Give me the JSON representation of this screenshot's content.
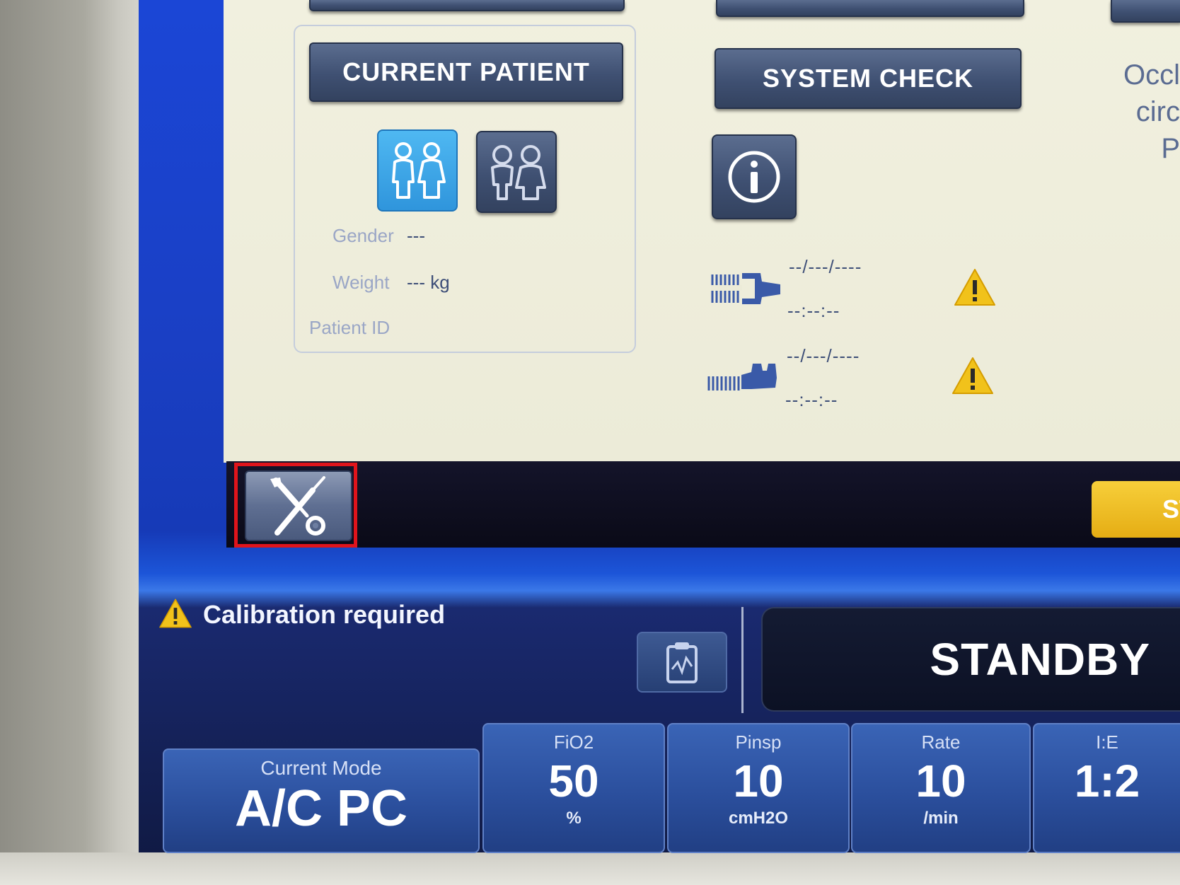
{
  "patient": {
    "button_label": "CURRENT PATIENT",
    "gender_label": "Gender",
    "gender_value": "---",
    "weight_label": "Weight",
    "weight_value": "--- kg",
    "patient_id_label": "Patient ID",
    "adult_selected": true
  },
  "system": {
    "check_label": "SYSTEM CHECK",
    "last_checks": [
      {
        "icon": "circuit-connector-icon",
        "date": "--/---/----",
        "time": "--:--:--",
        "status_icon": "warning-icon"
      },
      {
        "icon": "sensor-connector-icon",
        "date": "--/---/----",
        "time": "--:--:--",
        "status_icon": "warning-icon"
      }
    ]
  },
  "side_panel": {
    "text": "Occl\ncirc\nP"
  },
  "toolbar": {
    "start_label": "ST"
  },
  "status": {
    "message": "Calibration required",
    "state": "STANDBY"
  },
  "settings": {
    "mode": {
      "label": "Current Mode",
      "value": "A/C PC"
    },
    "fio2": {
      "label": "FiO2",
      "value": "50",
      "unit": "%"
    },
    "pinsp": {
      "label": "Pinsp",
      "value": "10",
      "unit": "cmH2O"
    },
    "rate": {
      "label": "Rate",
      "value": "10",
      "unit": "/min"
    },
    "ie": {
      "label": "I:E",
      "value": "1:2"
    }
  },
  "colors": {
    "frame_blue": "#1a3fc4",
    "panel_bg": "#f1f0df",
    "button_dark": "#3f5072",
    "selected_blue": "#2f95dc",
    "warning_yellow": "#f1c21b",
    "start_yellow": "#f0c22c",
    "highlight_red": "#e0141b",
    "tile_blue": "#2b4f9d"
  }
}
